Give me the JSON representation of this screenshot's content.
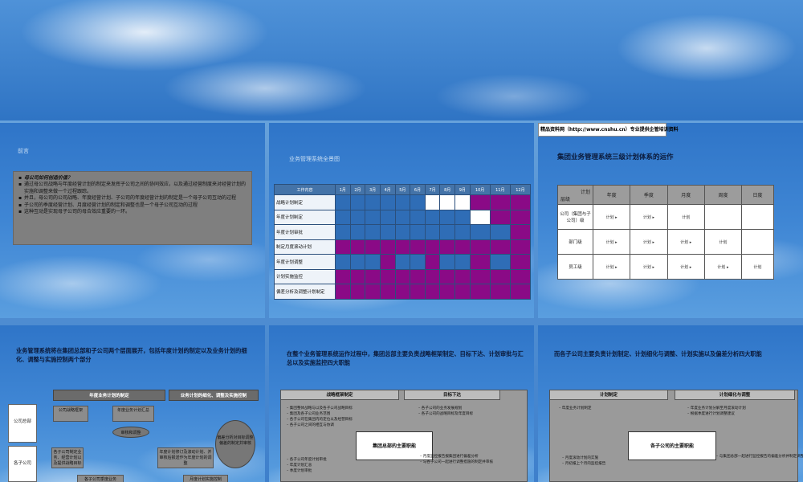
{
  "slide1": {
    "small_title": "前言",
    "bullets": [
      {
        "text": "母公司如何创造价值？",
        "bold": true
      },
      {
        "text": "通过母公司战略与年度经营计划的制定来发挥子公司之间的协同效应，以及通过经营制度来对经营计划的实施和调整来做一个过程跟踪。",
        "bold": false
      },
      {
        "text": "并且，母公司的公司战略、年度经营计划、子公司的年度经营计划的制定是一个母子公司互动的过程",
        "bold": false
      },
      {
        "text": "子公司的季度经营计划、月度经营计划的制定和调整也是一个母子公司互动的过程",
        "bold": false
      },
      {
        "text": "这种互动是实现母子公司的母合效应重要的一环。",
        "bold": false
      }
    ]
  },
  "slide2": {
    "small_title": "业务管理系统全景图",
    "col_header": "工作内容",
    "months": [
      "1月",
      "2月",
      "3月",
      "4月",
      "5月",
      "6月",
      "7月",
      "8月",
      "9月",
      "10月",
      "11月",
      "12月"
    ],
    "rows": [
      {
        "label": "战略计划制定",
        "cells": "bbbbbbwwwppp"
      },
      {
        "label": "年度计划制定",
        "cells": "bbbbbbbbbwpp"
      },
      {
        "label": "年度计划审批",
        "cells": "bbbbbbbbbbbp"
      },
      {
        "label": "制定月度滚动计划",
        "cells": "pppppppppppp"
      },
      {
        "label": "年度计划调整",
        "cells": "bbbpbbpbbpbp"
      },
      {
        "label": "计划实施监控",
        "cells": "pppppppppppp"
      },
      {
        "label": "偏差分析及调整计划制定",
        "cells": "pppppppppppp"
      }
    ]
  },
  "slide3": {
    "watermark": "精品资料网（http://www.cnshu.cn）专业提供企管培训资料",
    "title": "集团业务管理系统三级计划体系的运作",
    "corner_top": "计划",
    "corner_bottom": "层级",
    "cols": [
      "年度",
      "季度",
      "月度",
      "周度",
      "日度"
    ],
    "rows": [
      {
        "label": "公司（集团与子公司）级",
        "cells": [
          "计划",
          "计划",
          "计划",
          "",
          ""
        ]
      },
      {
        "label": "部门级",
        "cells": [
          "计划",
          "计划",
          "计划",
          "计划",
          ""
        ]
      },
      {
        "label": "员工级",
        "cells": [
          "计划",
          "计划",
          "计划",
          "计划",
          "计划"
        ]
      }
    ]
  },
  "slide4": {
    "title": "业务管理系统将在集团总部和子公司两个层面展开，包括年度计划的制定以及业务计划的细化、调整与实施控制两个部分",
    "header_left": "年度业务计划的制定",
    "header_right": "业务计划的细化、调整及实施控制",
    "side_hq": "公司总部",
    "side_sub": "各子公司",
    "box_strategy": "公司战略框架",
    "box_summary": "年度业务计划汇总",
    "oval_review": "审核和调整",
    "box_sub_draft": "各子公司制定业务、经营计划以及提供战略目标",
    "box_adjust": "年度计划修订及滚动计划、并审核后报送作为年度计划的调整",
    "oval_analysis": "偏差分析对目标调整偏差的制定并审核",
    "box_quarter": "各子公司季度业务",
    "box_month": "月度计划实施控制"
  },
  "slide5": {
    "title": "在整个业务管理系统运作过程中，集团总部主要负责战略框架制定、目标下达、计划审批与汇总以及实施监控四大职能",
    "head_left": "战略框架制定",
    "head_right": "目标下达",
    "left_items": [
      "集团整体战略与以及各子公司战略目标",
      "集团及各子公司业务范围",
      "各子公司在集团内的定位以及经营目标",
      "各子公司之间的相互与协调"
    ],
    "right_items": [
      "各子公司的业务发展规划",
      "各子公司的战略目标及年度目标"
    ],
    "center": "集团总部的主要职能",
    "lower_left": [
      "各子公司年度计划审批",
      "年度计划汇总",
      "季度计划审批"
    ],
    "lower_right": [
      "月度监控报告报集团进行偏差分析",
      "与各子公司一起进行调整措施的制定并审核"
    ]
  },
  "slide6": {
    "title": "而各子公司主要负责计划制定、计划细化与调整、计划实施以及偏差分析四大职能",
    "head_left": "计划制定",
    "head_right": "计划细化与调整",
    "left_items": [
      "年度业务计划制定"
    ],
    "right_items": [
      "年度业务计划分解至月度滚动计划",
      "根据季度进行计划调整建议"
    ],
    "center": "各子公司的主要职能",
    "lower_left": [
      "月度滚动计划的实施",
      "月初报上个月的监控报告"
    ],
    "lower_right": [
      "与集团总部一起进行监控报告的偏差分析并制定调整措施"
    ]
  }
}
